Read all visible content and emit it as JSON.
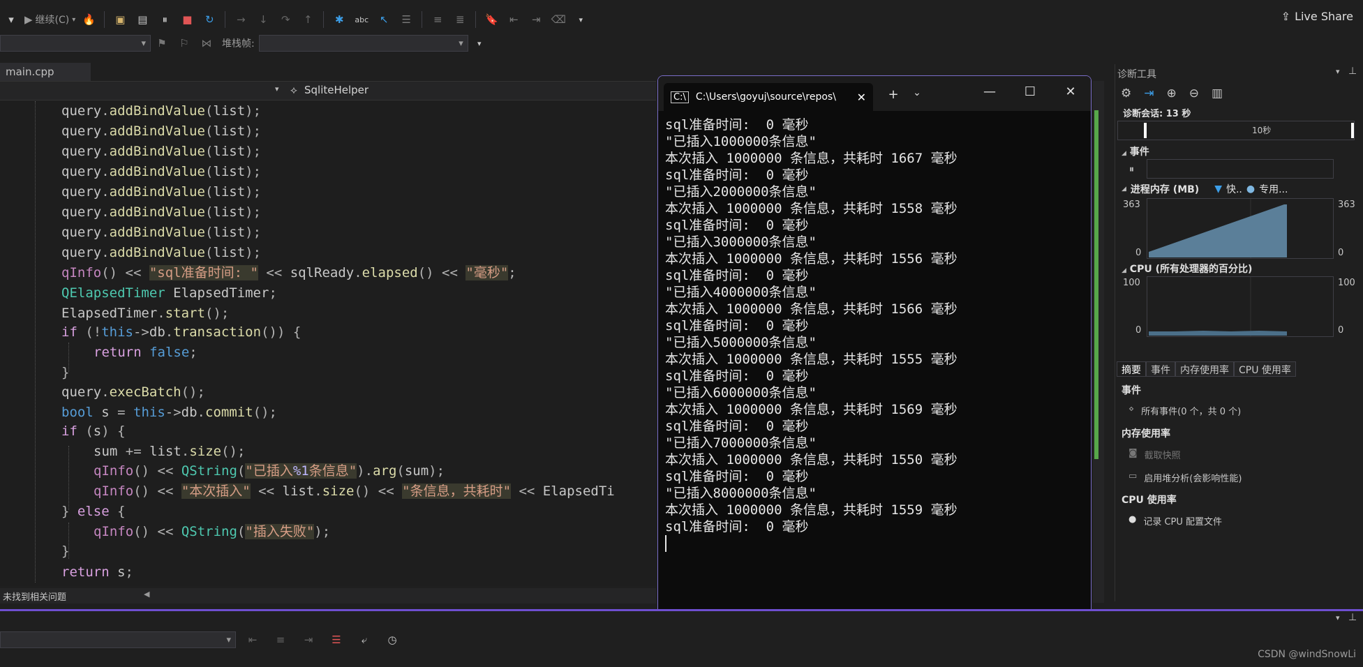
{
  "toolbar": {
    "continue_label": "继续(C)",
    "stack_frame_label": "堆栈帧:",
    "live_share_label": "Live Share"
  },
  "editor": {
    "tab_label": "main.cpp",
    "scope_label": "SqliteHelper",
    "status_text": "未找到相关问题"
  },
  "console": {
    "tab_title": "C:\\Users\\goyuj\\source\\repos\\",
    "lines": [
      "sql准备时间:  0 毫秒",
      "\"已插入1000000条信息\"",
      "本次插入 1000000 条信息，共耗时 1667 毫秒",
      "sql准备时间:  0 毫秒",
      "\"已插入2000000条信息\"",
      "本次插入 1000000 条信息，共耗时 1558 毫秒",
      "sql准备时间:  0 毫秒",
      "\"已插入3000000条信息\"",
      "本次插入 1000000 条信息，共耗时 1556 毫秒",
      "sql准备时间:  0 毫秒",
      "\"已插入4000000条信息\"",
      "本次插入 1000000 条信息，共耗时 1566 毫秒",
      "sql准备时间:  0 毫秒",
      "\"已插入5000000条信息\"",
      "本次插入 1000000 条信息，共耗时 1555 毫秒",
      "sql准备时间:  0 毫秒",
      "\"已插入6000000条信息\"",
      "本次插入 1000000 条信息，共耗时 1569 毫秒",
      "sql准备时间:  0 毫秒",
      "\"已插入7000000条信息\"",
      "本次插入 1000000 条信息，共耗时 1550 毫秒",
      "sql准备时间:  0 毫秒",
      "\"已插入8000000条信息\"",
      "本次插入 1000000 条信息，共耗时 1559 毫秒",
      "sql准备时间:  0 毫秒"
    ]
  },
  "diagnostics": {
    "title": "诊断工具",
    "session_label": "诊断会话: 13 秒",
    "timeline_tick": "10秒",
    "events_label": "事件",
    "memory_label": "进程内存 (MB)",
    "memory_legend_1": "快..",
    "memory_legend_2": "专用...",
    "memory_max": "363",
    "memory_min": "0",
    "cpu_label": "CPU (所有处理器的百分比)",
    "cpu_max": "100",
    "cpu_min": "0",
    "subtabs": [
      "摘要",
      "事件",
      "内存使用率",
      "CPU 使用率"
    ],
    "summary_events_heading": "事件",
    "all_events": "所有事件(0 个，共 0 个)",
    "memory_usage_heading": "内存使用率",
    "take_snapshot": "截取快照",
    "heap_profiling": "启用堆分析(会影响性能)",
    "cpu_usage_heading": "CPU 使用率",
    "record_cpu": "记录 CPU 配置文件",
    "colors": {
      "memory_fill": "#5b7f99",
      "cpu_fill": "#4b6f89"
    }
  },
  "watermark": "CSDN @windSnowLi"
}
